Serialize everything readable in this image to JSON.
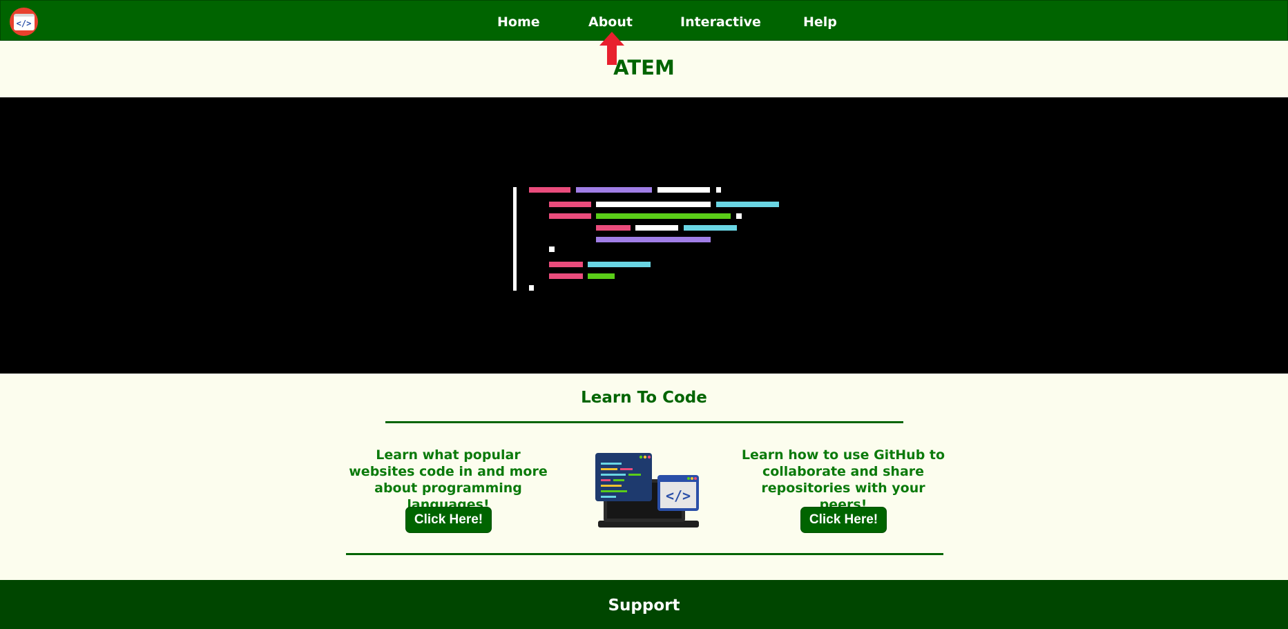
{
  "nav": {
    "logo_glyph": "</>",
    "links": [
      {
        "label": "Home"
      },
      {
        "label": "About"
      },
      {
        "label": "Interactive"
      },
      {
        "label": "Help"
      }
    ]
  },
  "header": {
    "title": "ATEM"
  },
  "learn": {
    "title": "Learn To Code",
    "left": {
      "text": "Learn what popular websites code in and more about programming languages!",
      "button": "Click Here!"
    },
    "right": {
      "text": "Learn how to use GitHub to collaborate and share repositories with your peers!",
      "button": "Click Here!"
    },
    "illustration_glyph": "</>"
  },
  "footer": {
    "title": "Support"
  },
  "colors": {
    "brand_green": "#006400",
    "footer_green": "#004600",
    "background": "#fcfdee",
    "text_green": "#0b7a0b",
    "annotation_arrow": "#e8202e",
    "code_pink": "#ea4c7c",
    "code_purple": "#a07ee6",
    "code_cyan": "#6ad6e4",
    "code_green": "#5acd18",
    "code_white": "#ffffff"
  }
}
